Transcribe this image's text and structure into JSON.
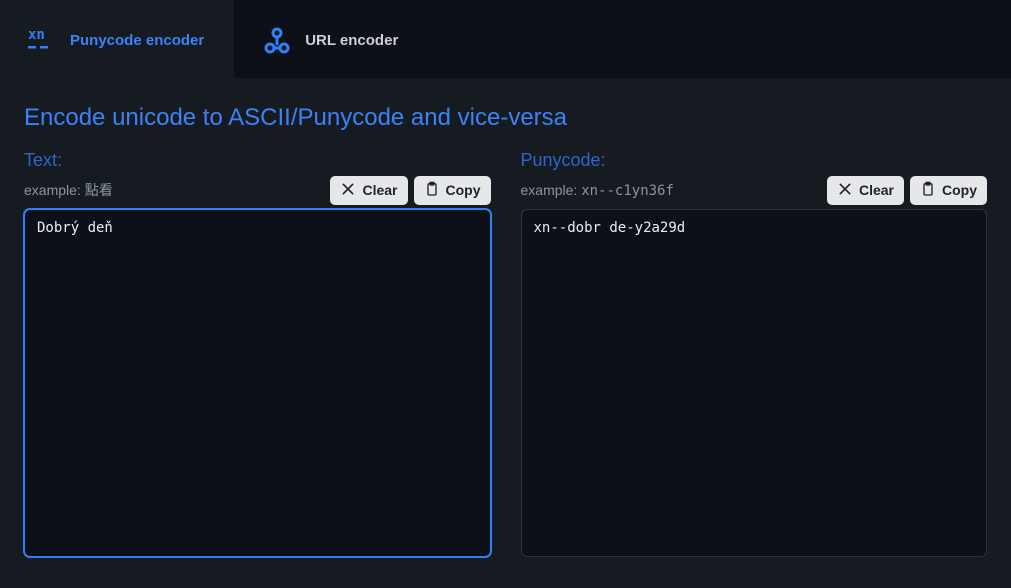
{
  "tabs": [
    {
      "label": "Punycode encoder",
      "active": true
    },
    {
      "label": "URL encoder",
      "active": false
    }
  ],
  "title": "Encode unicode to ASCII/Punycode and vice-versa",
  "left": {
    "heading": "Text:",
    "example_prefix": "example: ",
    "example_value": "點看",
    "clear_label": "Clear",
    "copy_label": "Copy",
    "value": "Dobrý deň"
  },
  "right": {
    "heading": "Punycode:",
    "example_prefix": "example: ",
    "example_value": "xn--c1yn36f",
    "clear_label": "Clear",
    "copy_label": "Copy",
    "value": "xn--dobr de-y2a29d"
  }
}
